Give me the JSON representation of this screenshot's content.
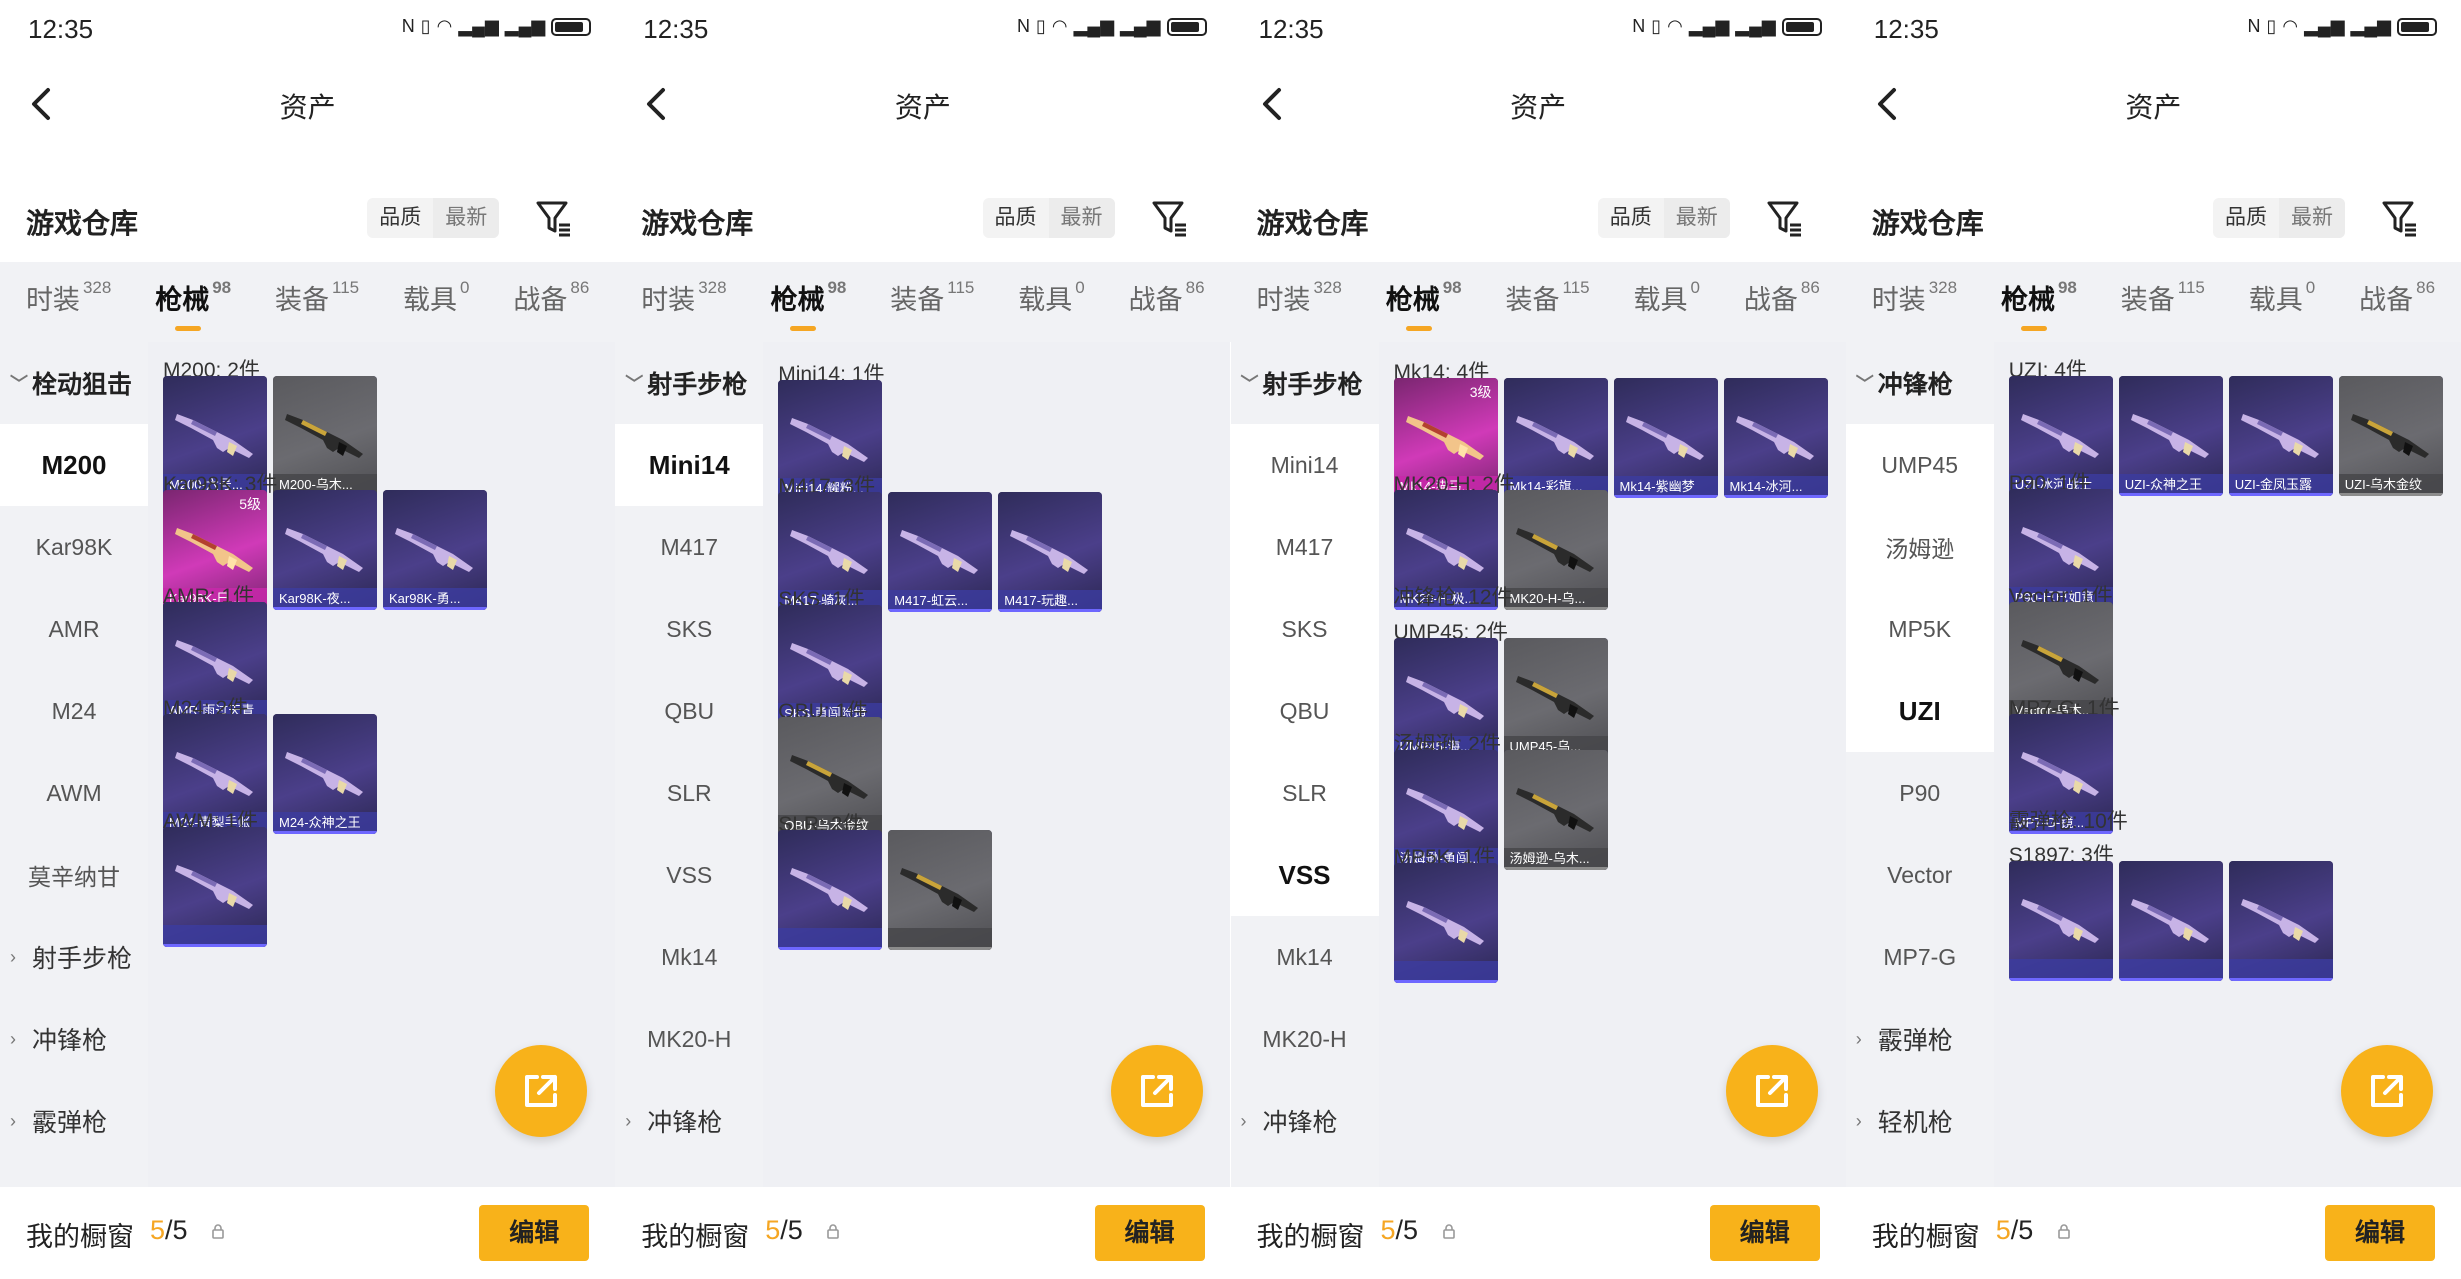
{
  "status": {
    "time": "12:35"
  },
  "nav": {
    "title": "资产"
  },
  "header": {
    "title": "游戏仓库",
    "sort_quality": "品质",
    "sort_latest": "最新"
  },
  "tabs": [
    {
      "label": "时装",
      "count": "328"
    },
    {
      "label": "枪械",
      "count": "98"
    },
    {
      "label": "装备",
      "count": "115"
    },
    {
      "label": "载具",
      "count": "0"
    },
    {
      "label": "战备",
      "count": "86"
    }
  ],
  "bottom": {
    "label": "我的橱窗",
    "count_current": "5",
    "count_sep": "/5",
    "edit": "编辑"
  },
  "colors": {
    "accent": "#f8b21a",
    "sidebar_bg": "#f1f2f5",
    "content_bg": "#eff0f4"
  },
  "panels": [
    {
      "sidebar": [
        {
          "label": "栓动狙击",
          "type": "open",
          "arrow": "﹀"
        },
        {
          "label": "M200",
          "type": "sel"
        },
        {
          "label": "Kar98K",
          "type": "item"
        },
        {
          "label": "AMR",
          "type": "item"
        },
        {
          "label": "M24",
          "type": "item"
        },
        {
          "label": "AWM",
          "type": "item"
        },
        {
          "label": "莫辛纳甘",
          "type": "item"
        },
        {
          "label": "射手步枪",
          "type": "group",
          "arrow": "›"
        },
        {
          "label": "冲锋枪",
          "type": "group",
          "arrow": "›"
        },
        {
          "label": "霰弹枪",
          "type": "group",
          "arrow": "›"
        }
      ],
      "sections": [
        {
          "title": "M200: 2件",
          "cards": [
            {
              "label": "M200-六号...",
              "style": "purple"
            },
            {
              "label": "M200-乌木...",
              "style": "gray"
            }
          ]
        },
        {
          "title": "Kar98K: 3件",
          "cards": [
            {
              "label": "Kar98K-巳...",
              "style": "pink",
              "level": "5级"
            },
            {
              "label": "Kar98K-夜...",
              "style": "purple"
            },
            {
              "label": "Kar98K-勇...",
              "style": "purple"
            }
          ]
        },
        {
          "title": "AMR: 1件",
          "cards": [
            {
              "label": "AMR-雨过天青",
              "style": "purple"
            }
          ]
        },
        {
          "title": "M24: 2件",
          "cards": [
            {
              "label": "M24-青梨手账",
              "style": "purple"
            },
            {
              "label": "M24-众神之王",
              "style": "purple"
            }
          ]
        },
        {
          "title": "AWM: 1件",
          "cards": [
            {
              "label": "",
              "style": "purple"
            }
          ]
        }
      ]
    },
    {
      "sidebar": [
        {
          "label": "射手步枪",
          "type": "open",
          "arrow": "﹀"
        },
        {
          "label": "Mini14",
          "type": "sel"
        },
        {
          "label": "M417",
          "type": "item"
        },
        {
          "label": "SKS",
          "type": "item"
        },
        {
          "label": "QBU",
          "type": "item"
        },
        {
          "label": "SLR",
          "type": "item"
        },
        {
          "label": "VSS",
          "type": "item"
        },
        {
          "label": "Mk14",
          "type": "item"
        },
        {
          "label": "MK20-H",
          "type": "item"
        },
        {
          "label": "冲锋枪",
          "type": "group",
          "arrow": "›"
        }
      ],
      "sections": [
        {
          "title": "Mini14: 1件",
          "cards": [
            {
              "label": "Mini14-耀粉...",
              "style": "purple"
            }
          ]
        },
        {
          "title": "M417: 3件",
          "cards": [
            {
              "label": "M417-骑灰...",
              "style": "purple"
            },
            {
              "label": "M417-虹云...",
              "style": "purple"
            },
            {
              "label": "M417-玩趣...",
              "style": "purple"
            }
          ]
        },
        {
          "title": "SKS: 1件",
          "cards": [
            {
              "label": "SKS-勇闯险境",
              "style": "purple"
            }
          ]
        },
        {
          "title": "QBU: 1件",
          "cards": [
            {
              "label": "QBU-乌木金纹",
              "style": "gray"
            }
          ]
        },
        {
          "title": "SLR: 2件",
          "cards": [
            {
              "label": "",
              "style": "purple"
            },
            {
              "label": "",
              "style": "gray"
            }
          ]
        }
      ]
    },
    {
      "sidebar": [
        {
          "label": "射手步枪",
          "type": "open",
          "arrow": "﹀"
        },
        {
          "label": "Mini14",
          "type": "white"
        },
        {
          "label": "M417",
          "type": "white"
        },
        {
          "label": "SKS",
          "type": "white"
        },
        {
          "label": "QBU",
          "type": "white"
        },
        {
          "label": "SLR",
          "type": "white"
        },
        {
          "label": "VSS",
          "type": "sel"
        },
        {
          "label": "Mk14",
          "type": "item"
        },
        {
          "label": "MK20-H",
          "type": "item"
        },
        {
          "label": "冲锋枪",
          "type": "group",
          "arrow": "›"
        }
      ],
      "sections": [
        {
          "title": "Mk14: 4件",
          "cards": [
            {
              "label": "Mk14-猫马...",
              "style": "pink",
              "level": "3级"
            },
            {
              "label": "Mk14-彩旗...",
              "style": "purple"
            },
            {
              "label": "Mk14-紫幽梦",
              "style": "purple"
            },
            {
              "label": "Mk14-冰河...",
              "style": "purple"
            }
          ]
        },
        {
          "title": "MK20-H: 2件",
          "cards": [
            {
              "label": "MK20-H-极...",
              "style": "purple"
            },
            {
              "label": "MK20-H-乌...",
              "style": "gray"
            }
          ]
        },
        {
          "title": "冲锋枪: 12件",
          "cards": []
        },
        {
          "title": "UMP45: 2件",
          "cards": [
            {
              "label": "UMP45-海...",
              "style": "purple"
            },
            {
              "label": "UMP45-乌...",
              "style": "gray"
            }
          ]
        },
        {
          "title": "汤姆逊: 2件",
          "cards": [
            {
              "label": "汤姆逊-勇闯...",
              "style": "purple"
            },
            {
              "label": "汤姆逊-乌木...",
              "style": "gray"
            }
          ]
        },
        {
          "title": "MP5K: 1件",
          "cards": [
            {
              "label": "",
              "style": "purple"
            }
          ]
        }
      ]
    },
    {
      "sidebar": [
        {
          "label": "冲锋枪",
          "type": "open",
          "arrow": "﹀"
        },
        {
          "label": "UMP45",
          "type": "white"
        },
        {
          "label": "汤姆逊",
          "type": "white"
        },
        {
          "label": "MP5K",
          "type": "white"
        },
        {
          "label": "UZI",
          "type": "sel"
        },
        {
          "label": "P90",
          "type": "item"
        },
        {
          "label": "Vector",
          "type": "item"
        },
        {
          "label": "MP7-G",
          "type": "item"
        },
        {
          "label": "霰弹枪",
          "type": "group",
          "arrow": "›"
        },
        {
          "label": "轻机枪",
          "type": "group",
          "arrow": "›"
        }
      ],
      "sections": [
        {
          "title": "UZI: 4件",
          "cards": [
            {
              "label": "UZI-冰河战士",
              "style": "purple"
            },
            {
              "label": "UZI-众神之王",
              "style": "purple"
            },
            {
              "label": "UZI-金凤玉露",
              "style": "purple"
            },
            {
              "label": "UZI-乌木金纹",
              "style": "gray"
            }
          ]
        },
        {
          "title": "P90: 1件",
          "cards": [
            {
              "label": "P90-巳巳如意",
              "style": "purple"
            }
          ]
        },
        {
          "title": "Vector: 1件",
          "cards": [
            {
              "label": "Vector-乌木...",
              "style": "gray"
            }
          ]
        },
        {
          "title": "MP7-G: 1件",
          "cards": [
            {
              "label": "MP7-G-镜...",
              "style": "purple"
            }
          ]
        },
        {
          "title": "霰弹枪: 10件",
          "cards": []
        },
        {
          "title": "S1897: 3件",
          "cards": [
            {
              "label": "",
              "style": "purple"
            },
            {
              "label": "",
              "style": "purple"
            },
            {
              "label": "",
              "style": "purple"
            }
          ]
        }
      ]
    }
  ]
}
